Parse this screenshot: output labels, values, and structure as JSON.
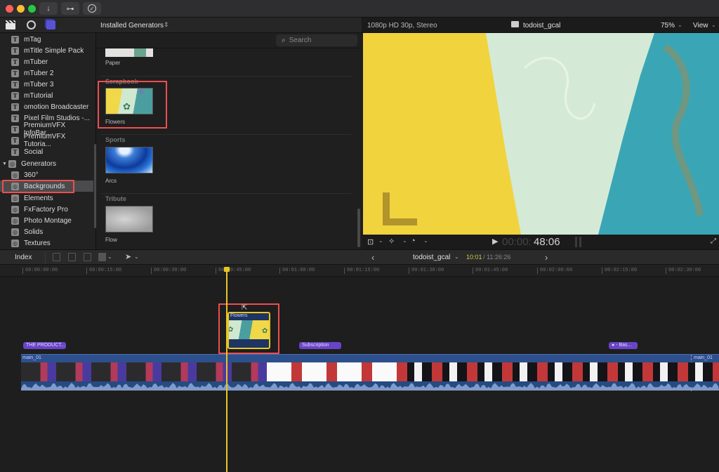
{
  "window": {
    "traffic_lights": {
      "close": "#fe5f57",
      "minimize": "#febc2e",
      "maximize": "#28c840"
    },
    "toolbar_buttons": [
      {
        "name": "import-button",
        "icon": "download-arrow-icon",
        "glyph": "↓"
      },
      {
        "name": "keywords-button",
        "icon": "key-icon",
        "glyph": "⊶"
      },
      {
        "name": "background-tasks-button",
        "icon": "checkmark-circle-icon",
        "glyph": "✓"
      }
    ]
  },
  "library": {
    "header_icons": [
      "clapper-icon",
      "music-photo-icon",
      "titles-generators-icon"
    ],
    "items": [
      {
        "label": "mTag",
        "icon": "T"
      },
      {
        "label": "mTitle Simple Pack",
        "icon": "T"
      },
      {
        "label": "mTuber",
        "icon": "T"
      },
      {
        "label": "mTuber 2",
        "icon": "T"
      },
      {
        "label": "mTuber 3",
        "icon": "T"
      },
      {
        "label": "mTutorial",
        "icon": "T"
      },
      {
        "label": "omotion Broadcaster",
        "icon": "T"
      },
      {
        "label": "Pixel Film Studios -...",
        "icon": "T"
      },
      {
        "label": "PremiumVFX InfoBar...",
        "icon": "T"
      },
      {
        "label": "PremiumVFX Tutoria...",
        "icon": "T"
      },
      {
        "label": "Social",
        "icon": "T"
      }
    ],
    "generators_group": {
      "label": "Generators",
      "expanded": true
    },
    "generator_items": [
      {
        "label": "360°",
        "selected": false
      },
      {
        "label": "Backgrounds",
        "selected": true
      },
      {
        "label": "Elements",
        "selected": false
      },
      {
        "label": "FxFactory Pro",
        "selected": false
      },
      {
        "label": "Photo Montage",
        "selected": false
      },
      {
        "label": "Solids",
        "selected": false
      },
      {
        "label": "Textures",
        "selected": false
      }
    ]
  },
  "browser": {
    "title": "Installed Generators",
    "search_placeholder": "Search",
    "sections": [
      {
        "category": "",
        "items": [
          {
            "label": "Paper"
          }
        ]
      },
      {
        "category": "Scrapbook",
        "items": [
          {
            "label": "Flowers",
            "highlighted": true
          }
        ]
      },
      {
        "category": "Sports",
        "items": [
          {
            "label": "Arcs"
          }
        ]
      },
      {
        "category": "Tribute",
        "items": [
          {
            "label": "Flow"
          }
        ]
      }
    ]
  },
  "viewer": {
    "format": "1080p HD 30p, Stereo",
    "project_name": "todoist_gcal",
    "zoom": "75%",
    "view_menu": "View",
    "timecode_dim": "00:00:",
    "timecode": "48:06",
    "overlay_letter": "L"
  },
  "timeline_toolbar": {
    "index_label": "Index",
    "project_name": "todoist_gcal",
    "position": "10:01",
    "duration": "/ 11:26:26",
    "back_glyph": "‹",
    "forward_glyph": "›"
  },
  "ruler": {
    "ticks": [
      "00:00:00:00",
      "00:00:15:00",
      "00:00:30:00",
      "00:00:45:00",
      "00:01:00:00",
      "00:01:15:00",
      "00:01:30:00",
      "00:01:45:00",
      "00:02:00:00",
      "00:02:15:00",
      "00:02:30:00"
    ]
  },
  "timeline": {
    "connected_clip": {
      "label": "Flowers",
      "highlighted": true
    },
    "title_clips": [
      {
        "label": "THE PRODUCT..."
      },
      {
        "label": "Subscription"
      },
      {
        "label": "● - Bas..."
      }
    ],
    "primary_clips": [
      {
        "label": "main_01"
      },
      {
        "label": "main_01"
      }
    ]
  },
  "colors": {
    "highlight": "#ee4e4e",
    "playhead": "#e9c623",
    "title_clip": "#6845c6",
    "primary_track": "#2d4f8c",
    "timecode_position": "#c8c84a"
  }
}
